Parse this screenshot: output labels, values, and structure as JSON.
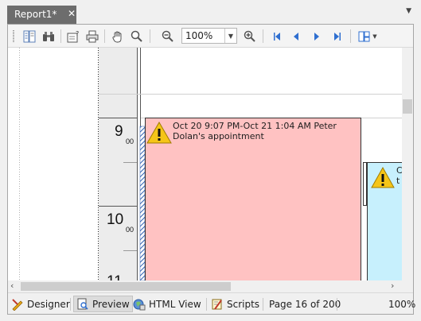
{
  "tab": {
    "title": "Report1*",
    "close": "✕",
    "dropdown": "▼"
  },
  "toolbar": {
    "zoom_value": "100%",
    "buttons": [
      "document-map",
      "search",
      "page-setup",
      "print",
      "hand-tool",
      "magnifier",
      "zoom-out",
      "zoom-in",
      "first-page",
      "previous-page",
      "next-page",
      "last-page",
      "multiple-pages"
    ]
  },
  "scheduler": {
    "hours": [
      {
        "hour": "9",
        "minutes": "00"
      },
      {
        "hour": "10",
        "minutes": "00"
      },
      {
        "hour": "11",
        "minutes": ""
      }
    ],
    "appointment1": {
      "text": "Oct 20 9:07 PM-Oct 21 1:04 AM Peter Dolan's appointment",
      "color": "#ffc2c2"
    },
    "appointment2": {
      "text": "C t",
      "color": "#c7f0fd"
    }
  },
  "statusbar": {
    "designer": "Designer",
    "preview": "Preview",
    "html_view": "HTML View",
    "scripts": "Scripts",
    "page_info": "Page 16 of 200",
    "zoom": "100%"
  },
  "scroll": {
    "left": "‹",
    "right": "›"
  }
}
